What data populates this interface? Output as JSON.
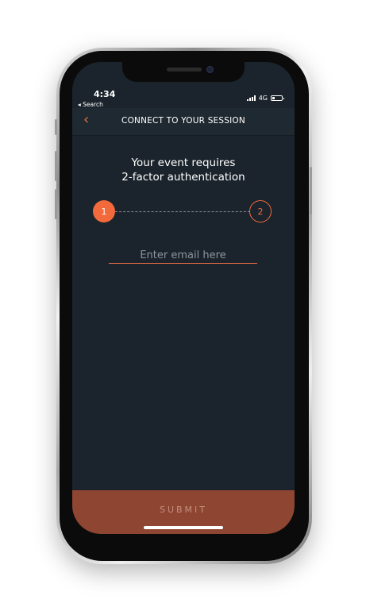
{
  "status_bar": {
    "time": "4:34",
    "back_label": "◂ Search",
    "network": "4G"
  },
  "nav": {
    "back_icon": "chevron-left-icon",
    "title": "CONNECT TO YOUR SESSION"
  },
  "heading": {
    "line1": "Your event requires",
    "line2": "2-factor authentication"
  },
  "steps": [
    {
      "label": "1",
      "active": true
    },
    {
      "label": "2",
      "active": false
    }
  ],
  "email": {
    "placeholder": "Enter email here",
    "value": ""
  },
  "submit": {
    "label": "SUBMIT"
  },
  "colors": {
    "accent": "#f26a3c",
    "background": "#1b242c",
    "submit_bg": "#8e4531"
  }
}
